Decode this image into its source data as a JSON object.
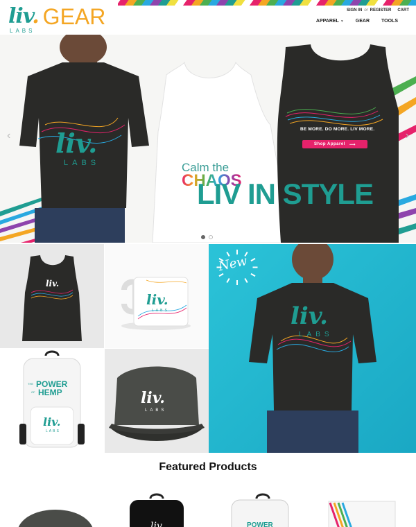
{
  "brand": {
    "logo_liv": "liv",
    "logo_dot": ".",
    "logo_labs": "LABS",
    "logo_gear": "GEAR",
    "accent_color": "#1f9d92",
    "gear_color": "#f4a623"
  },
  "account": {
    "sign_in": "SIGN IN",
    "or": "or",
    "register": "REGISTER",
    "cart": "CART"
  },
  "nav": {
    "apparel": "APPAREL",
    "gear": "GEAR",
    "tools": "TOOLS"
  },
  "hero": {
    "headline": "LIV IN STYLE",
    "tagline": "BE MORE. DO MORE. LIV MORE.",
    "shop_button": "Shop Apparel",
    "tank_calm": "Calm the",
    "tank_chaos": "CHAOS",
    "shirt_liv": "liv.",
    "shirt_labs": "LABS",
    "slide_count": 2,
    "active_slide": 1,
    "button_color": "#e6226b"
  },
  "grid": {
    "new_badge": "New",
    "tank_logo": "liv.",
    "mug_logo": "liv.",
    "mug_labs": "LABS",
    "backpack_power": "POWER",
    "backpack_hemp": "HEMP",
    "backpack_the": "THE",
    "backpack_of": "OF",
    "backpack_logo": "liv.",
    "backpack_labs": "LABS",
    "hat_logo": "liv.",
    "hat_labs": "LABS",
    "model_logo": "liv.",
    "model_labs": "LABS",
    "new_bg_color": "#22b8d1"
  },
  "featured": {
    "title": "Featured Products",
    "backpack_text": "POWER"
  }
}
